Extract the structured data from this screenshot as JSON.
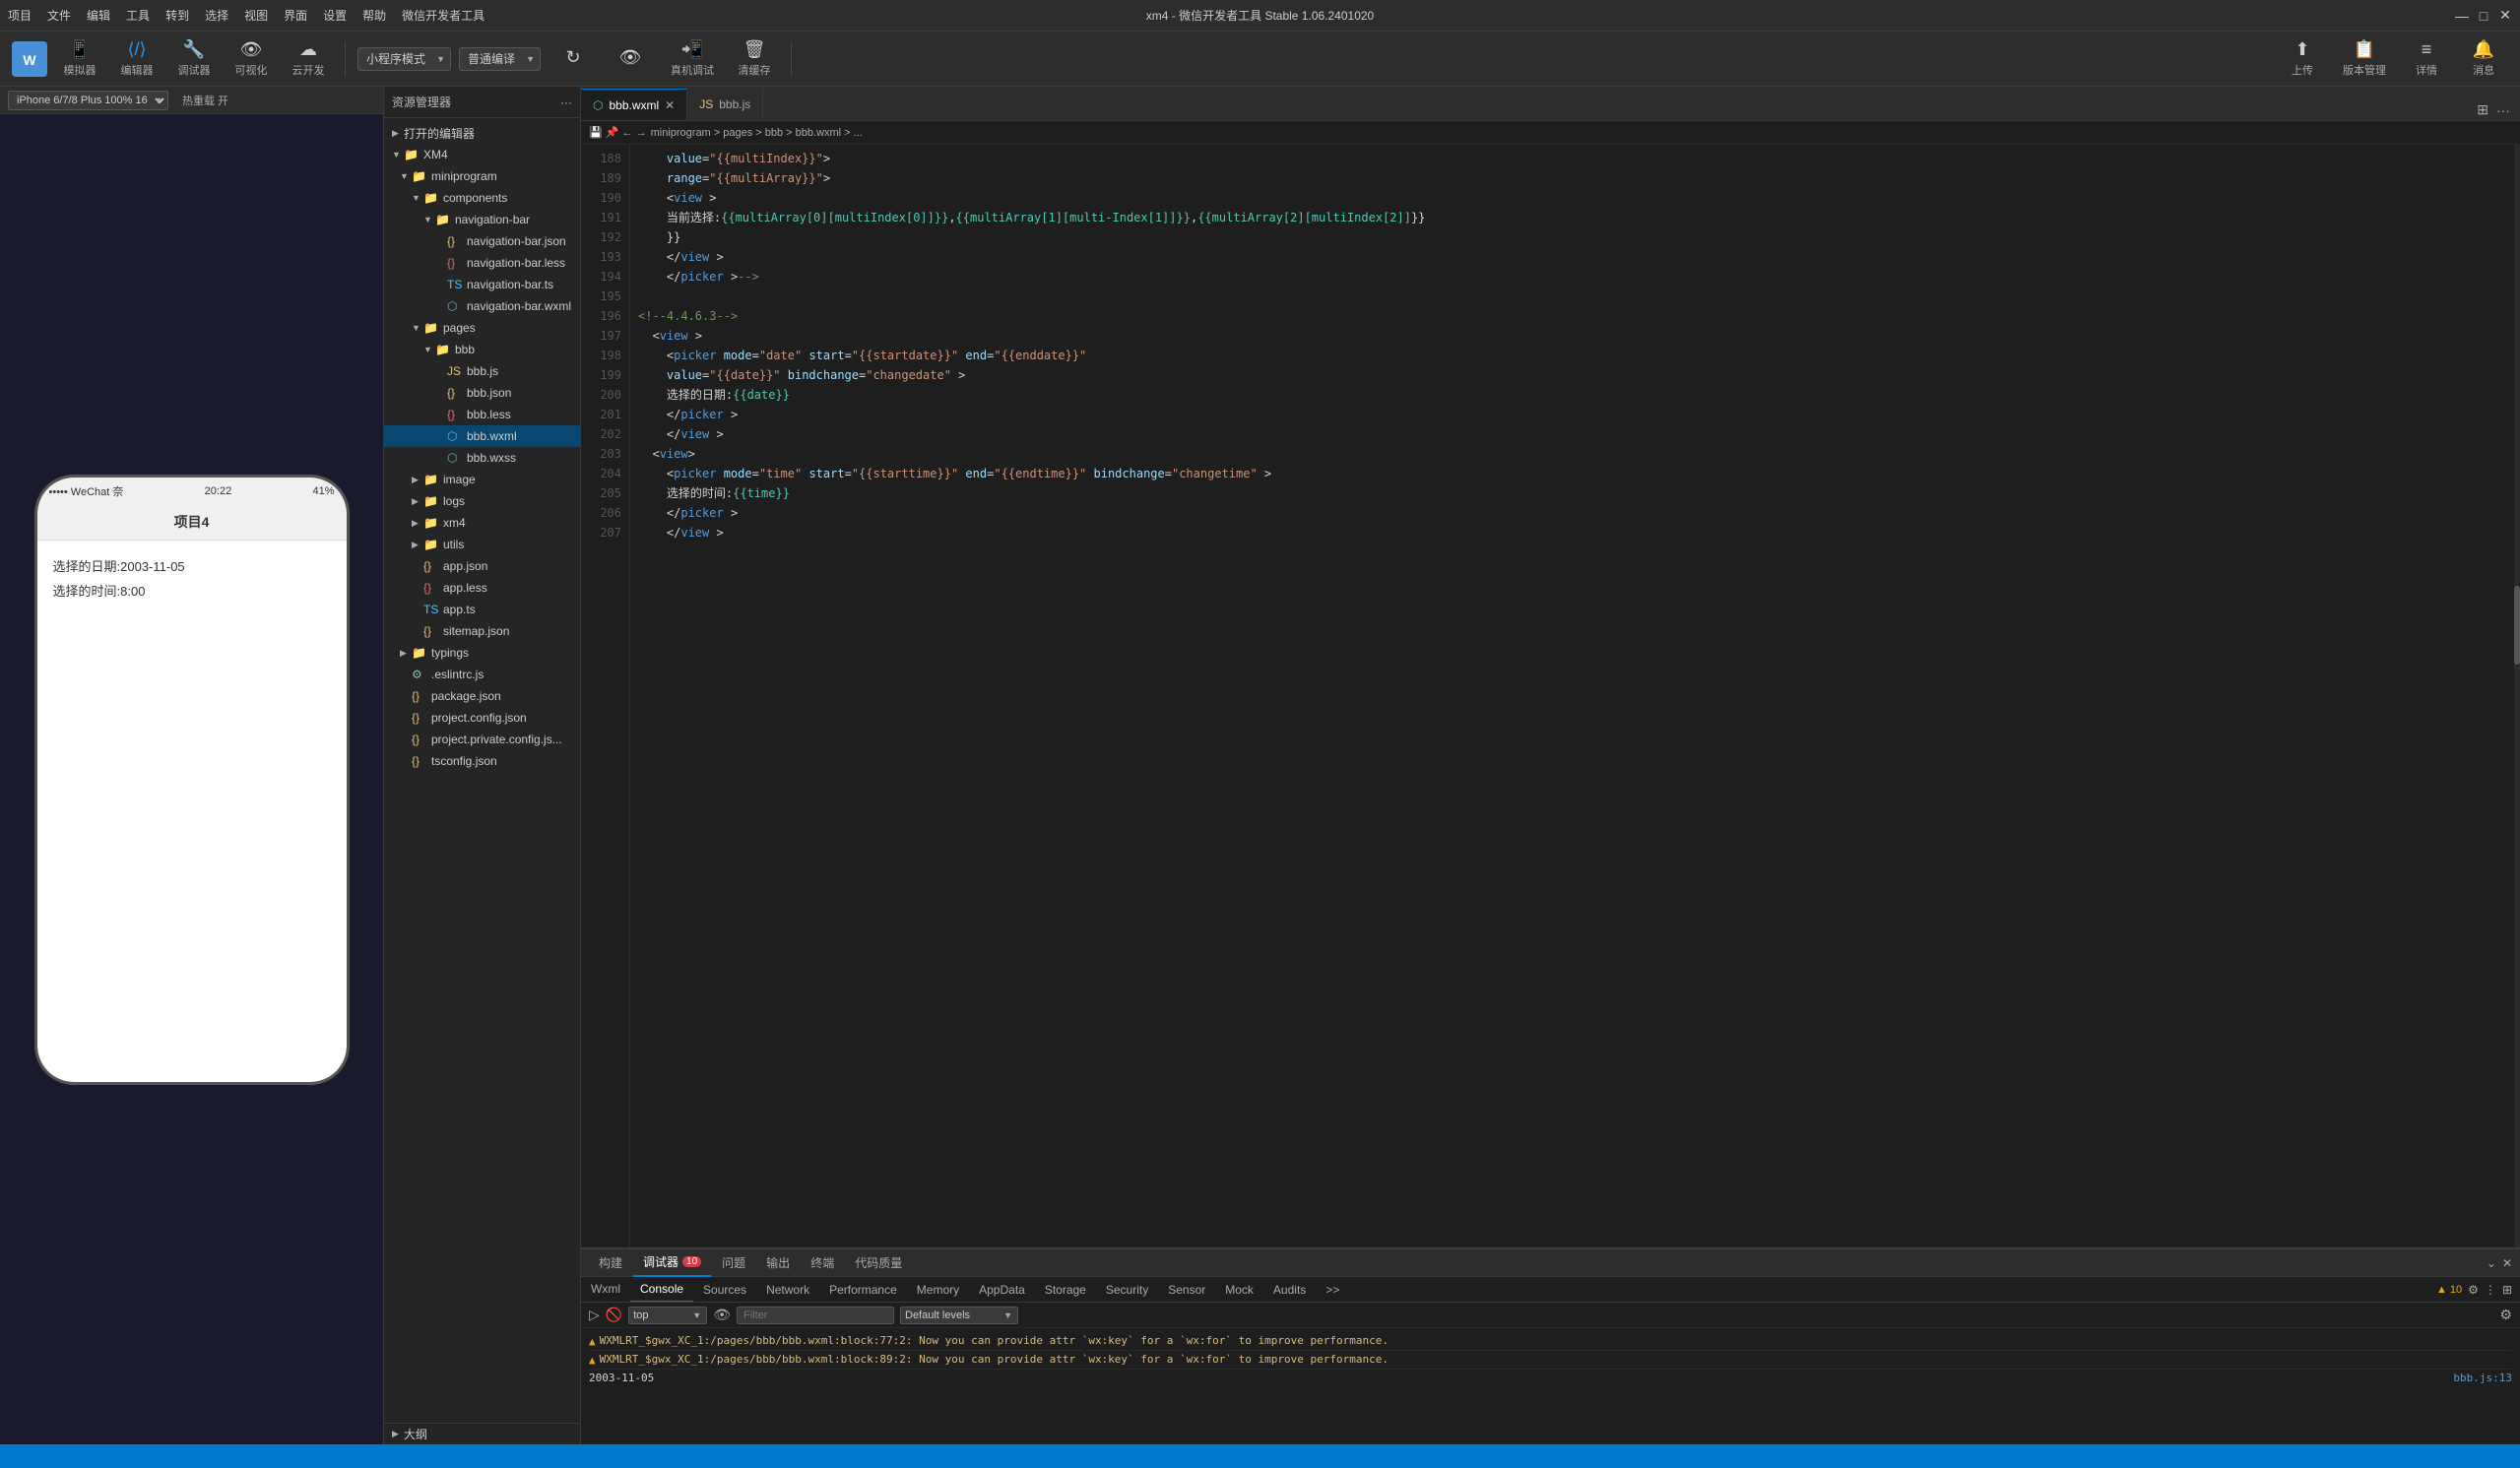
{
  "app": {
    "title": "xm4 - 微信开发者工具 Stable 1.06.2401020"
  },
  "menubar": {
    "items": [
      "项目",
      "文件",
      "编辑",
      "工具",
      "转到",
      "选择",
      "视图",
      "界面",
      "设置",
      "帮助",
      "微信开发者工具"
    ]
  },
  "titlebar_controls": {
    "minimize": "—",
    "maximize": "□",
    "close": "✕"
  },
  "toolbar": {
    "logo_icon": "W",
    "simulator_label": "模拟器",
    "editor_label": "编辑器",
    "debugger_label": "调试器",
    "visualize_label": "可视化",
    "cloud_label": "云开发",
    "mode_select": "小程序模式",
    "compile_select": "普通编译",
    "compile_icon": "↻",
    "preview_icon": "👁",
    "realdevice_label": "真机调试",
    "cache_label": "清缓存",
    "upload_label": "上传",
    "version_label": "版本管理",
    "detail_label": "详情",
    "notification_label": "消息"
  },
  "simulator": {
    "device_select": "iPhone 6/7/8 Plus 100% 16",
    "hotreload": "热重载 开",
    "statusbar_icons": "••••• WeChat 奈",
    "statusbar_time": "20:22",
    "statusbar_battery": "41%",
    "page_title": "项目4",
    "selected_date_label": "选择的日期:",
    "selected_date_value": "2003-11-05",
    "selected_time_label": "选择的时间:",
    "selected_time_value": "8:00"
  },
  "explorer": {
    "title": "资源管理器",
    "opened_editors": "打开的编辑器",
    "project_name": "XM4",
    "items": [
      {
        "name": "miniprogram",
        "type": "folder",
        "indent": 2,
        "expanded": true
      },
      {
        "name": "components",
        "type": "folder",
        "indent": 3,
        "expanded": true
      },
      {
        "name": "navigation-bar",
        "type": "folder",
        "indent": 4,
        "expanded": true
      },
      {
        "name": "navigation-bar.json",
        "type": "json",
        "indent": 5
      },
      {
        "name": "navigation-bar.less",
        "type": "less",
        "indent": 5
      },
      {
        "name": "navigation-bar.ts",
        "type": "ts",
        "indent": 5
      },
      {
        "name": "navigation-bar.wxml",
        "type": "wxml",
        "indent": 5
      },
      {
        "name": "pages",
        "type": "folder",
        "indent": 3,
        "expanded": true
      },
      {
        "name": "bbb",
        "type": "folder",
        "indent": 4,
        "expanded": true
      },
      {
        "name": "bbb.js",
        "type": "js",
        "indent": 5
      },
      {
        "name": "bbb.json",
        "type": "json",
        "indent": 5
      },
      {
        "name": "bbb.less",
        "type": "less",
        "indent": 5
      },
      {
        "name": "bbb.wxml",
        "type": "wxml",
        "indent": 5,
        "selected": true
      },
      {
        "name": "bbb.wxss",
        "type": "wxss",
        "indent": 5
      },
      {
        "name": "image",
        "type": "folder",
        "indent": 3
      },
      {
        "name": "logs",
        "type": "folder",
        "indent": 3
      },
      {
        "name": "xm4",
        "type": "folder",
        "indent": 3
      },
      {
        "name": "utils",
        "type": "folder",
        "indent": 3
      },
      {
        "name": "app.json",
        "type": "json",
        "indent": 3
      },
      {
        "name": "app.less",
        "type": "less",
        "indent": 3
      },
      {
        "name": "app.ts",
        "type": "ts",
        "indent": 3
      },
      {
        "name": "sitemap.json",
        "type": "json",
        "indent": 3
      },
      {
        "name": "typings",
        "type": "folder",
        "indent": 2
      },
      {
        "name": ".eslintrc.js",
        "type": "js",
        "indent": 2
      },
      {
        "name": "package.json",
        "type": "json",
        "indent": 2
      },
      {
        "name": "project.config.json",
        "type": "json",
        "indent": 2
      },
      {
        "name": "project.private.config.js...",
        "type": "json",
        "indent": 2
      },
      {
        "name": "tsconfig.json",
        "type": "json",
        "indent": 2
      }
    ],
    "outline_label": "大纲"
  },
  "editor": {
    "tabs": [
      {
        "name": "bbb.wxml",
        "type": "wxml",
        "active": true
      },
      {
        "name": "bbb.js",
        "type": "js",
        "active": false
      }
    ],
    "breadcrumb": "miniprogram > pages > bbb > bbb.wxml > ...",
    "lines": [
      {
        "num": 188,
        "content": "    value=\"{{multiIndex}}\">"
      },
      {
        "num": 189,
        "content": "    range=\"{{multiArray}}\">"
      },
      {
        "num": 190,
        "content": "    <view >"
      },
      {
        "num": 191,
        "content": "    当前选择:{{multiArray[0][multiIndex[0]]}},{{multiArray[1][multi-Index[1]]}},{{multiArray[2][multiIndex[2]]}}"
      },
      {
        "num": 192,
        "content": "    </view >"
      },
      {
        "num": 193,
        "content": "    </picker >-->"
      },
      {
        "num": 194,
        "content": ""
      },
      {
        "num": 195,
        "content": "<!--4.4.6.3-->"
      },
      {
        "num": 196,
        "content": "  <view >"
      },
      {
        "num": 197,
        "content": "    <picker mode=\"date\" start=\"{{startdate}}\" end=\"{{enddate}}\""
      },
      {
        "num": 198,
        "content": "    value=\"{{date}}\" bindchange=\"changedate\" >"
      },
      {
        "num": 199,
        "content": "    选择的日期:{{date}}"
      },
      {
        "num": 200,
        "content": "    </picker >"
      },
      {
        "num": 201,
        "content": "    </view >"
      },
      {
        "num": 202,
        "content": "  <view>"
      },
      {
        "num": 203,
        "content": "    <picker mode=\"time\" start=\"{{starttime}}\" end=\"{{endtime}}\" bindchange=\"changetime\" >"
      },
      {
        "num": 204,
        "content": "    选择的时间:{{time}}"
      },
      {
        "num": 205,
        "content": "    </picker >"
      },
      {
        "num": 206,
        "content": "    </view >"
      },
      {
        "num": 207,
        "content": ""
      }
    ]
  },
  "bottom_panel": {
    "tabs": [
      {
        "name": "构建",
        "active": false
      },
      {
        "name": "调试器",
        "badge": "10",
        "active": true
      },
      {
        "name": "问题",
        "active": false
      },
      {
        "name": "输出",
        "active": false
      },
      {
        "name": "终端",
        "active": false
      },
      {
        "name": "代码质量",
        "active": false
      }
    ],
    "console_tabs": [
      "Wxml",
      "Console",
      "Sources",
      "Network",
      "Performance",
      "Memory",
      "AppData",
      "Storage",
      "Security",
      "Sensor",
      "Mock",
      "Audits"
    ],
    "active_console_tab": "Console",
    "filter_placeholder": "Filter",
    "default_levels": "Default levels",
    "top_filter": "top",
    "warning_count": "▲ 10",
    "messages": [
      {
        "type": "warning",
        "text": "▲ WXMLRT_$gwx_XC_1:/pages/bbb/bbb.wxml:block:77:2: Now you can provide attr `wx:key` for a `wx:for` to improve performance.",
        "source": ""
      },
      {
        "type": "warning",
        "text": "▲ WXMLRT_$gwx_XC_1:/pages/bbb/bbb.wxml:block:89:2: Now you can provide attr `wx:key` for a `wx:for` to improve performance.",
        "source": ""
      },
      {
        "type": "info",
        "text": "2003-11-05",
        "source": "bbb.js:13"
      }
    ]
  },
  "statusbar": {
    "text": ""
  }
}
